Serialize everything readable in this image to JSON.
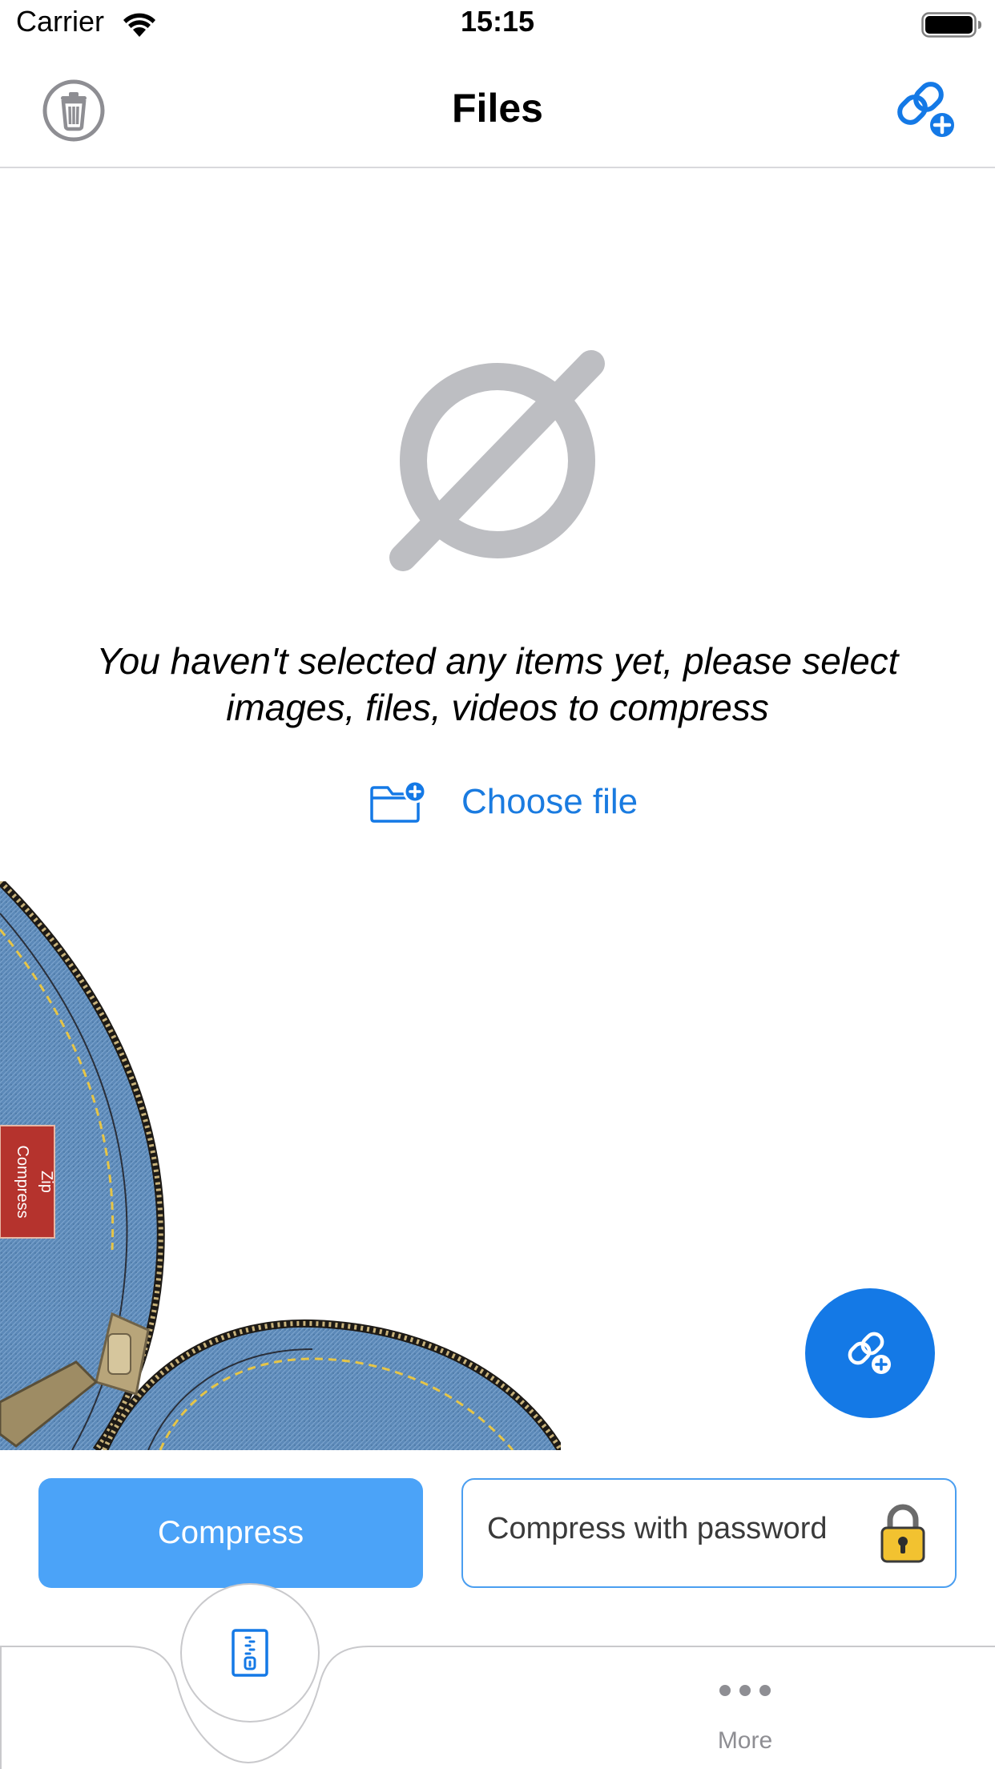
{
  "status_bar": {
    "carrier": "Carrier",
    "time": "15:15"
  },
  "nav": {
    "title": "Files",
    "left_icon": "trash-icon",
    "right_icon": "link-add-icon"
  },
  "empty_state": {
    "icon": "empty-set-icon",
    "message": "You haven't selected any items yet, please select images, files, videos to compress",
    "choose_file_label": "Choose file"
  },
  "decoration": {
    "tag_text": "Zip Compress"
  },
  "fab": {
    "icon": "link-add-icon"
  },
  "actions": {
    "compress_label": "Compress",
    "compress_password_label": "Compress with password"
  },
  "tab_bar": {
    "center_icon": "zip-file-icon",
    "more_label": "More"
  },
  "colors": {
    "accent": "#1479e6",
    "compress_button": "#4ba3f8",
    "empty_icon": "#bdbec2",
    "denim": "#5a86b4"
  }
}
